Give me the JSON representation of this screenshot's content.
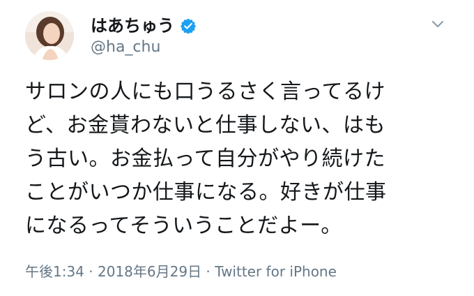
{
  "user": {
    "display_name": "はあちゅう",
    "handle": "@ha_chu",
    "verified": true,
    "avatar_icon": "profile-photo",
    "verified_icon": "verified-badge-icon",
    "verified_color": "#1da1f2"
  },
  "tweet": {
    "lines": [
      "サロンの人にも口うるさく言ってるけ",
      "ど、お金貰わないと仕事しない、はも",
      "う古い。お金払って自分がやり続けた",
      "ことがいつか仕事になる。好きが仕事",
      "になるってそういうことだよー。"
    ],
    "time": "午後1:34",
    "separator_1": " · ",
    "date": "2018年6月29日",
    "separator_2": " · ",
    "source": "Twitter for iPhone"
  },
  "menu": {
    "caret_icon": "chevron-down-icon"
  }
}
